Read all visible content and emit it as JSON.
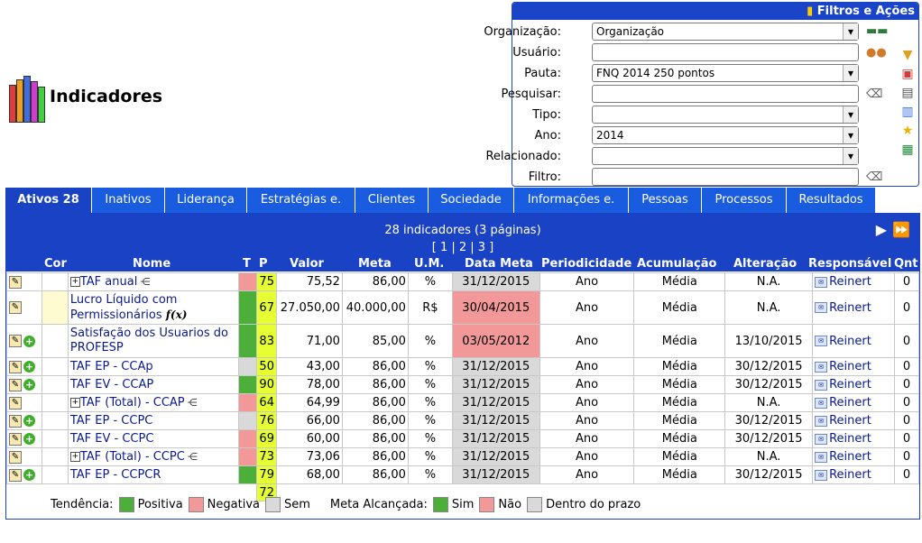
{
  "page_title": "Indicadores",
  "filters": {
    "header": "Filtros e Ações",
    "organizacao": {
      "label": "Organização:",
      "value": "Organização"
    },
    "usuario": {
      "label": "Usuário:",
      "value": ""
    },
    "pauta": {
      "label": "Pauta:",
      "value": "FNQ 2014 250 pontos"
    },
    "pesquisar": {
      "label": "Pesquisar:",
      "value": ""
    },
    "tipo": {
      "label": "Tipo:",
      "value": ""
    },
    "ano": {
      "label": "Ano:",
      "value": "2014"
    },
    "relacionado": {
      "label": "Relacionado:",
      "value": ""
    },
    "filtro": {
      "label": "Filtro:",
      "value": ""
    }
  },
  "tabs": [
    {
      "label": "Ativos 28"
    },
    {
      "label": "Inativos"
    },
    {
      "label": "Liderança"
    },
    {
      "label": "Estratégias e."
    },
    {
      "label": "Clientes"
    },
    {
      "label": "Sociedade"
    },
    {
      "label": "Informações e."
    },
    {
      "label": "Pessoas"
    },
    {
      "label": "Processos"
    },
    {
      "label": "Resultados"
    }
  ],
  "table": {
    "count": "28 indicadores (3 páginas)",
    "pages": "[ 1 | 2 | 3 ]",
    "headers": {
      "cor": "Cor",
      "nome": "Nome",
      "t": "T",
      "p": "P",
      "valor": "Valor",
      "meta": "Meta",
      "um": "U.M.",
      "data_meta": "Data Meta",
      "periodicidade": "Periodicidade",
      "acumulacao": "Acumulação",
      "alteracao": "Alteração",
      "responsavel": "Responsável",
      "qnt": "Qnt"
    },
    "rows": [
      {
        "nome": "TAF anual",
        "t": "#f29898",
        "p": "75",
        "valor": "75,52",
        "meta": "86,00",
        "um": "%",
        "data": "31/12/2015",
        "late": false,
        "per": "Ano",
        "acum": "Média",
        "alt": "N.A.",
        "resp": "Reinert",
        "qnt": "0"
      },
      {
        "nome": "Lucro Líquido com Permissionários",
        "t": "#4caf3a",
        "p": "67",
        "valor": "27.050,00",
        "meta": "40.000,00",
        "um": "R$",
        "data": "30/04/2015",
        "late": true,
        "per": "Ano",
        "acum": "Média",
        "alt": "N.A.",
        "resp": "Reinert",
        "qnt": "0"
      },
      {
        "nome": "Satisfação dos Usuarios do PROFESP",
        "t": "#4caf3a",
        "p": "83",
        "valor": "71,00",
        "meta": "85,00",
        "um": "%",
        "data": "03/05/2012",
        "late": true,
        "per": "Ano",
        "acum": "Média",
        "alt": "13/10/2015",
        "resp": "Reinert",
        "qnt": "0"
      },
      {
        "nome": "TAF EP - CCAp",
        "t": "#d9d9d9",
        "p": "50",
        "valor": "43,00",
        "meta": "86,00",
        "um": "%",
        "data": "31/12/2015",
        "late": false,
        "per": "Ano",
        "acum": "Média",
        "alt": "30/12/2015",
        "resp": "Reinert",
        "qnt": "0"
      },
      {
        "nome": "TAF EV - CCAP",
        "t": "#4caf3a",
        "p": "90",
        "valor": "78,00",
        "meta": "86,00",
        "um": "%",
        "data": "31/12/2015",
        "late": false,
        "per": "Ano",
        "acum": "Média",
        "alt": "30/12/2015",
        "resp": "Reinert",
        "qnt": "0"
      },
      {
        "nome": "TAF (Total) - CCAP",
        "t": "#f29898",
        "p": "64",
        "valor": "64,99",
        "meta": "86,00",
        "um": "%",
        "data": "31/12/2015",
        "late": false,
        "per": "Ano",
        "acum": "Média",
        "alt": "N.A.",
        "resp": "Reinert",
        "qnt": "0"
      },
      {
        "nome": "TAF EP - CCPC",
        "t": "#d9d9d9",
        "p": "76",
        "valor": "66,00",
        "meta": "86,00",
        "um": "%",
        "data": "31/12/2015",
        "late": false,
        "per": "Ano",
        "acum": "Média",
        "alt": "30/12/2015",
        "resp": "Reinert",
        "qnt": "0"
      },
      {
        "nome": "TAF EV - CCPC",
        "t": "#f29898",
        "p": "69",
        "valor": "60,00",
        "meta": "86,00",
        "um": "%",
        "data": "31/12/2015",
        "late": false,
        "per": "Ano",
        "acum": "Média",
        "alt": "30/12/2015",
        "resp": "Reinert",
        "qnt": "0"
      },
      {
        "nome": "TAF (Total) - CCPC",
        "t": "#f29898",
        "p": "73",
        "valor": "73,06",
        "meta": "86,00",
        "um": "%",
        "data": "31/12/2015",
        "late": false,
        "per": "Ano",
        "acum": "Média",
        "alt": "N.A.",
        "resp": "Reinert",
        "qnt": "0"
      },
      {
        "nome": "TAF EP - CCPCR",
        "t": "#4caf3a",
        "p": "79",
        "valor": "68,00",
        "meta": "86,00",
        "um": "%",
        "data": "31/12/2015",
        "late": false,
        "per": "Ano",
        "acum": "Média",
        "alt": "30/12/2015",
        "resp": "Reinert",
        "qnt": "0"
      }
    ],
    "footer_p": "72"
  },
  "legend": {
    "tendencia": "Tendência:",
    "positiva": "Positiva",
    "negativa": "Negativa",
    "sem": "Sem",
    "meta_alcancada": "Meta Alcançada:",
    "sim": "Sim",
    "nao": "Não",
    "dentro_prazo": "Dentro do prazo",
    "colors": {
      "green": "#4caf3a",
      "red": "#f29898",
      "grey": "#d9d9d9"
    }
  }
}
